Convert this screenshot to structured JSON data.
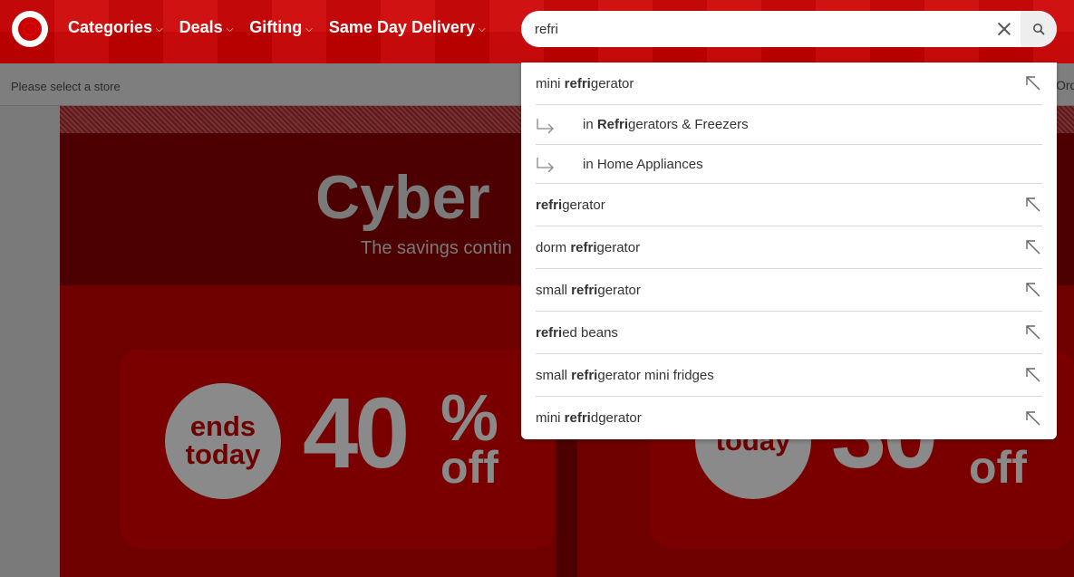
{
  "header": {
    "nav": [
      {
        "label": "Categories"
      },
      {
        "label": "Deals"
      },
      {
        "label": "Gifting"
      },
      {
        "label": "Same Day Delivery"
      }
    ],
    "chevron_glyph": "⌵",
    "search": {
      "value": "refri"
    }
  },
  "subbar": {
    "store_prompt": "Please select a store",
    "orders_partial": "Ord"
  },
  "banner": {
    "title": "Cyber",
    "subtitle": "The savings contin",
    "left_card": {
      "badge_line1": "ends",
      "badge_line2": "today",
      "percent": "40",
      "percent_sign": "%",
      "off": "off"
    },
    "right_card": {
      "badge_line2": "today",
      "percent": "30",
      "off": "off"
    }
  },
  "suggestions": [
    {
      "pre": "mini ",
      "bold": "refri",
      "post": "gerator",
      "kind": "term"
    },
    {
      "pre": "in ",
      "bold": "Refri",
      "post": "gerators & Freezers",
      "kind": "category"
    },
    {
      "pre": "in Home Appliances",
      "bold": "",
      "post": "",
      "kind": "category"
    },
    {
      "pre": "",
      "bold": "refri",
      "post": "gerator",
      "kind": "term"
    },
    {
      "pre": "dorm ",
      "bold": "refri",
      "post": "gerator",
      "kind": "term"
    },
    {
      "pre": "small ",
      "bold": "refri",
      "post": "gerator",
      "kind": "term"
    },
    {
      "pre": "",
      "bold": "refri",
      "post": "ed beans",
      "kind": "term"
    },
    {
      "pre": "small ",
      "bold": "refri",
      "post": "gerator mini fridges",
      "kind": "term"
    },
    {
      "pre": "mini ",
      "bold": "refri",
      "post": "dgerator",
      "kind": "term"
    }
  ],
  "colors": {
    "brand_red": "#cc0000"
  }
}
